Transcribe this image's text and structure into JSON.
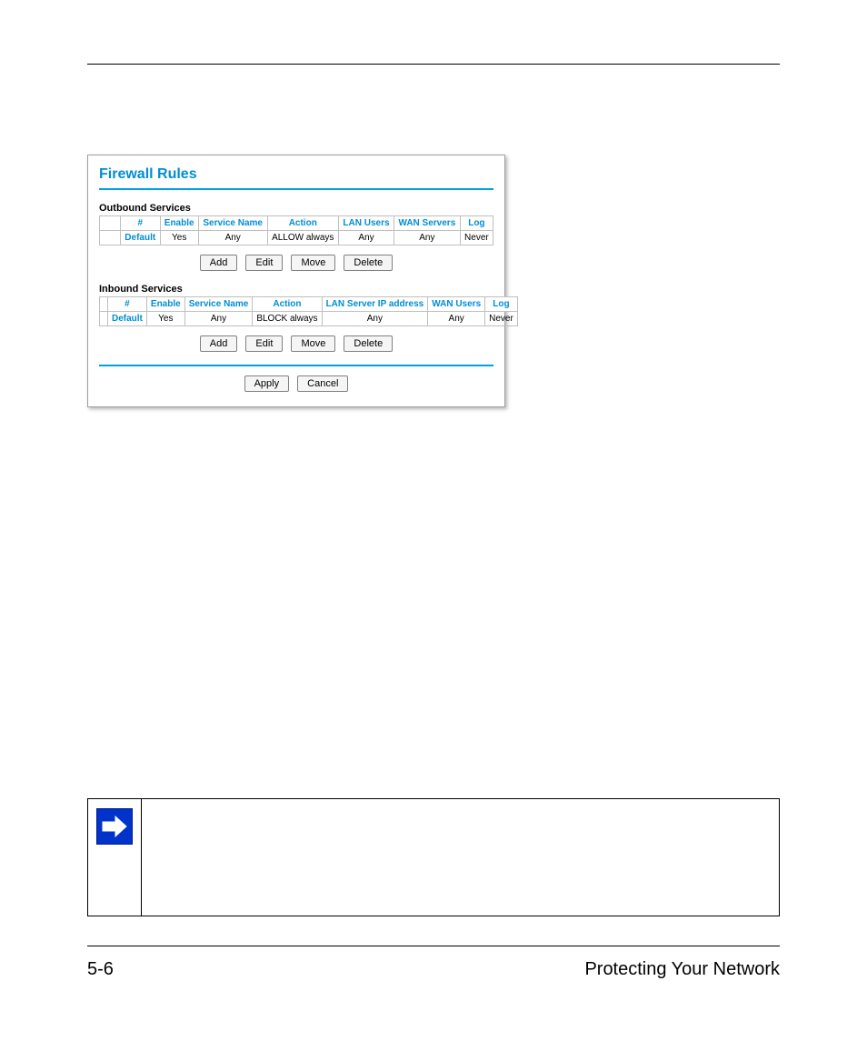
{
  "footer": {
    "page_number": "5-6",
    "section_title": "Protecting Your Network"
  },
  "panel": {
    "title": "Firewall Rules",
    "outbound": {
      "label": "Outbound Services",
      "headers": [
        "",
        "#",
        "Enable",
        "Service Name",
        "Action",
        "LAN Users",
        "WAN Servers",
        "Log"
      ],
      "row": {
        "sel": "",
        "num": "Default",
        "enable": "Yes",
        "service_name": "Any",
        "action": "ALLOW always",
        "lan_users": "Any",
        "wan_servers": "Any",
        "log": "Never"
      }
    },
    "inbound": {
      "label": "Inbound Services",
      "headers": [
        "",
        "#",
        "Enable",
        "Service Name",
        "Action",
        "LAN Server IP address",
        "WAN Users",
        "Log"
      ],
      "row": {
        "sel": "",
        "num": "Default",
        "enable": "Yes",
        "service_name": "Any",
        "action": "BLOCK always",
        "lan_ip": "Any",
        "wan_users": "Any",
        "log": "Never"
      }
    },
    "buttons": {
      "add": "Add",
      "edit": "Edit",
      "move": "Move",
      "del": "Delete",
      "apply": "Apply",
      "cancel": "Cancel"
    }
  }
}
